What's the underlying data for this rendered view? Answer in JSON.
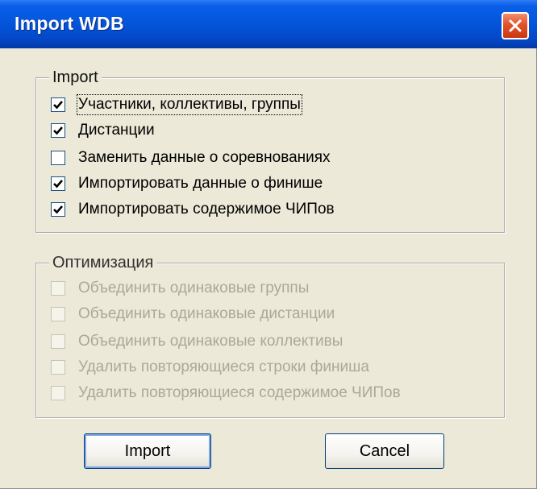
{
  "window": {
    "title": "Import WDB",
    "close_icon": "close-icon"
  },
  "import_group": {
    "legend": "Import",
    "items": [
      {
        "label": "Участники, коллективы, группы",
        "checked": true,
        "focused": true
      },
      {
        "label": "Дистанции",
        "checked": true
      },
      {
        "label": "Заменить данные о соревнованиях",
        "checked": false
      },
      {
        "label": "Импортировать данные о финише",
        "checked": true
      },
      {
        "label": "Импортировать содержимое ЧИПов",
        "checked": true
      }
    ]
  },
  "optimization_group": {
    "legend": "Оптимизация",
    "disabled": true,
    "items": [
      {
        "label": "Объединить одинаковые группы",
        "checked": false
      },
      {
        "label": "Объединить одинаковые дистанции",
        "checked": false
      },
      {
        "label": "Объединить одинаковые коллективы",
        "checked": false
      },
      {
        "label": "Удалить повторяющиеся строки финиша",
        "checked": false
      },
      {
        "label": "Удалить повторяющиеся содержимое ЧИПов",
        "checked": false
      }
    ]
  },
  "buttons": {
    "import_label": "Import",
    "cancel_label": "Cancel"
  },
  "colors": {
    "titlebar": "#0456dc",
    "window_bg": "#ece9d8",
    "close_button": "#e2522a",
    "disabled_text": "#aca899"
  }
}
